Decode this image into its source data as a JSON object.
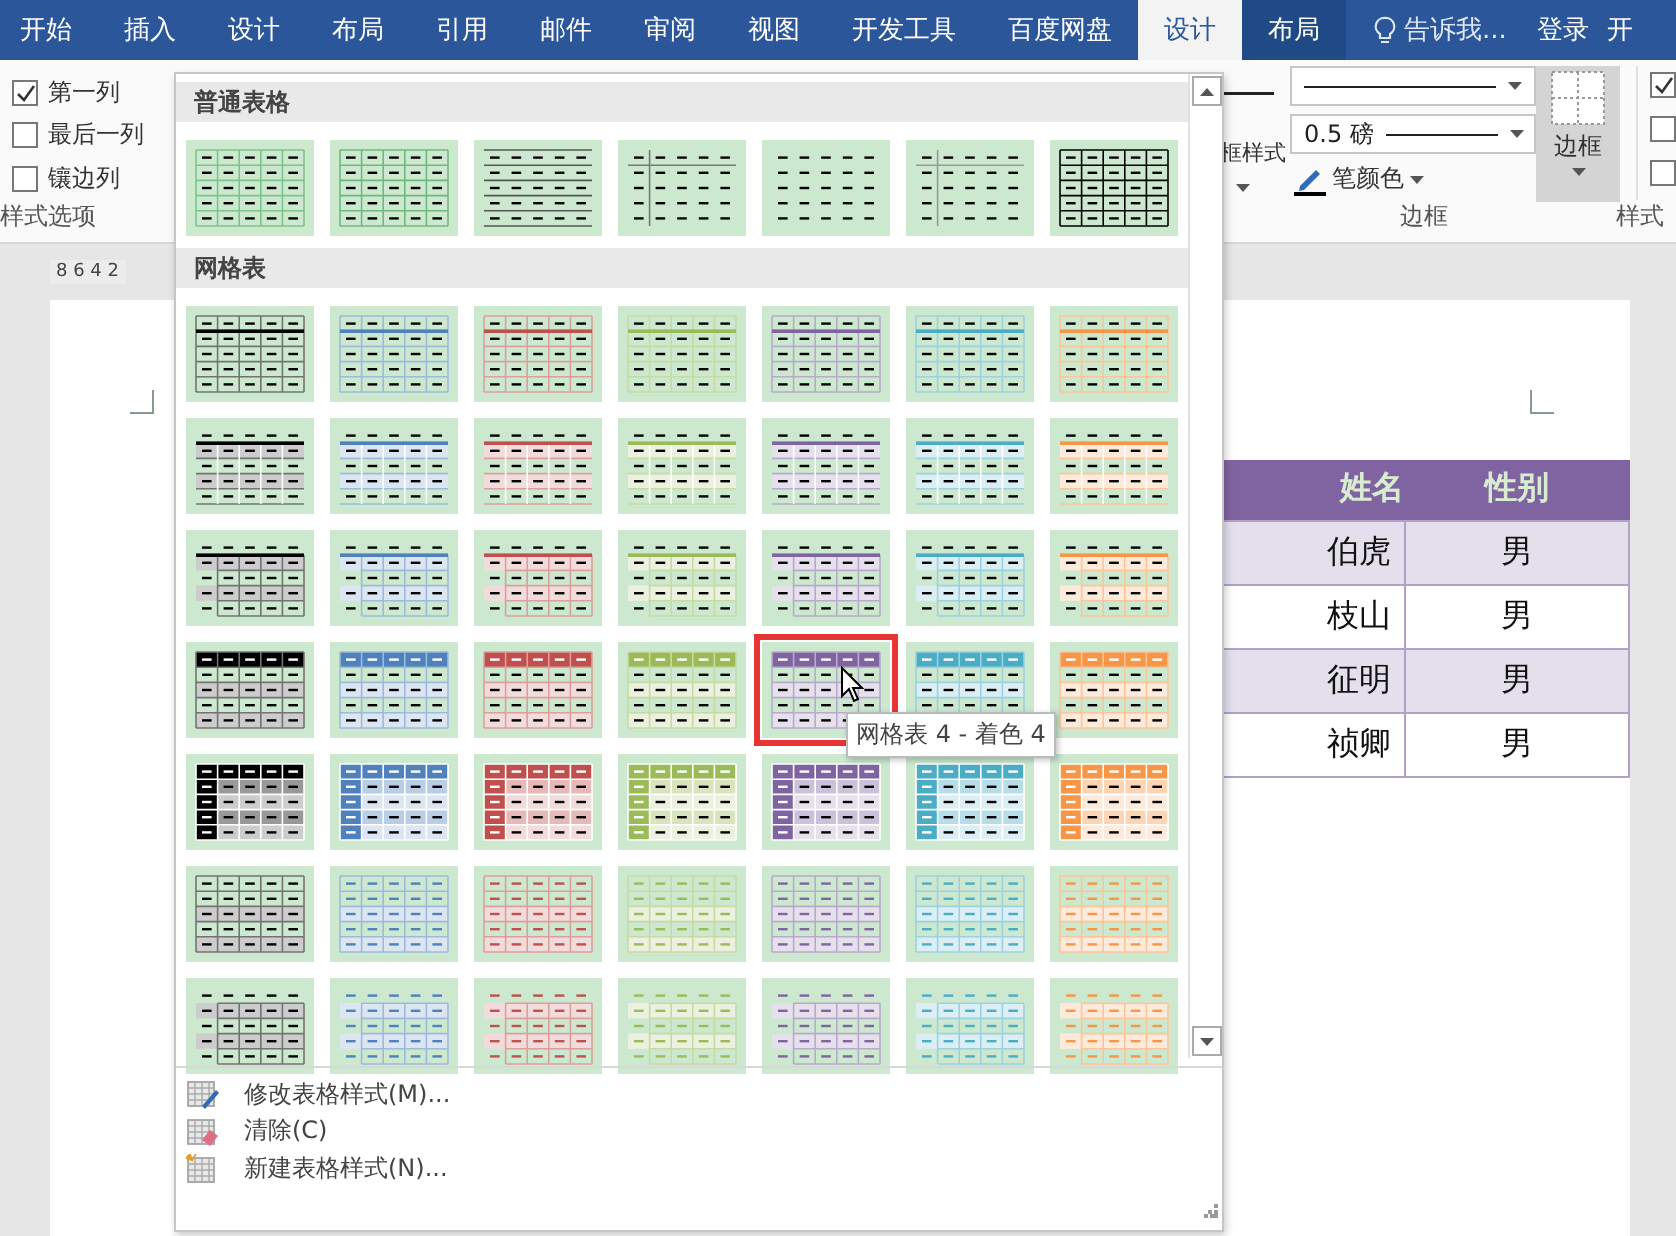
{
  "tabs": [
    {
      "label": "开始",
      "selected": false,
      "kind": "main"
    },
    {
      "label": "插入",
      "selected": false,
      "kind": "main"
    },
    {
      "label": "设计",
      "selected": false,
      "kind": "main"
    },
    {
      "label": "布局",
      "selected": false,
      "kind": "main"
    },
    {
      "label": "引用",
      "selected": false,
      "kind": "main"
    },
    {
      "label": "邮件",
      "selected": false,
      "kind": "main"
    },
    {
      "label": "审阅",
      "selected": false,
      "kind": "main"
    },
    {
      "label": "视图",
      "selected": false,
      "kind": "main"
    },
    {
      "label": "开发工具",
      "selected": false,
      "kind": "main"
    },
    {
      "label": "百度网盘",
      "selected": false,
      "kind": "main"
    },
    {
      "label": "设计",
      "selected": true,
      "kind": "context"
    },
    {
      "label": "布局",
      "selected": false,
      "kind": "context"
    }
  ],
  "tell_me": "告诉我...",
  "sign_in": "登录",
  "cut_tab": "开",
  "style_options": {
    "items": [
      {
        "label": "第一列",
        "checked": true
      },
      {
        "label": "最后一列",
        "checked": false
      },
      {
        "label": "镶边列",
        "checked": false
      }
    ],
    "group_label": "样式选项"
  },
  "borders": {
    "border_styles_label": "框样式",
    "pen_weight": "0.5 磅",
    "pen_color_label": "笔颜色",
    "borders_button": "边框",
    "group_label": "边框"
  },
  "right_options": {
    "items": [
      {
        "checked": true
      },
      {
        "checked": false
      },
      {
        "checked": false
      }
    ],
    "group_label": "样式"
  },
  "ruler": "8 6 4 2",
  "document_table": {
    "columns": [
      "姓名",
      "性别"
    ],
    "rows": [
      [
        "伯虎",
        "男"
      ],
      [
        "枝山",
        "男"
      ],
      [
        "征明",
        "男"
      ],
      [
        "祯卿",
        "男"
      ]
    ]
  },
  "gallery": {
    "sections": [
      {
        "title": "普通表格",
        "items": [
          {
            "kind": "plain-grid-light",
            "selected": false
          },
          {
            "kind": "plain-grid",
            "selected": false
          },
          {
            "kind": "plain-rules",
            "selected": false
          },
          {
            "kind": "plain-corner",
            "selected": false
          },
          {
            "kind": "plain-none",
            "selected": false
          },
          {
            "kind": "plain-corner-light",
            "selected": false
          },
          {
            "kind": "plain-grid-dark",
            "selected": false
          }
        ]
      },
      {
        "title": "网格表",
        "items": [
          {
            "kind": "grid1",
            "color": "#000000",
            "selected": false
          },
          {
            "kind": "grid1",
            "color": "#4f81bd",
            "selected": false
          },
          {
            "kind": "grid1",
            "color": "#c0504d",
            "selected": false
          },
          {
            "kind": "grid1",
            "color": "#9bbb59",
            "selected": false
          },
          {
            "kind": "grid1",
            "color": "#8064a2",
            "selected": false
          },
          {
            "kind": "grid1",
            "color": "#4bacc6",
            "selected": false
          },
          {
            "kind": "grid1",
            "color": "#f79646",
            "selected": false
          },
          {
            "kind": "grid2",
            "color": "#000000",
            "selected": false
          },
          {
            "kind": "grid2",
            "color": "#4f81bd",
            "selected": false
          },
          {
            "kind": "grid2",
            "color": "#c0504d",
            "selected": false
          },
          {
            "kind": "grid2",
            "color": "#9bbb59",
            "selected": false
          },
          {
            "kind": "grid2",
            "color": "#8064a2",
            "selected": false
          },
          {
            "kind": "grid2",
            "color": "#4bacc6",
            "selected": false
          },
          {
            "kind": "grid2",
            "color": "#f79646",
            "selected": false
          },
          {
            "kind": "grid3",
            "color": "#000000",
            "selected": false
          },
          {
            "kind": "grid3",
            "color": "#4f81bd",
            "selected": false
          },
          {
            "kind": "grid3",
            "color": "#c0504d",
            "selected": false
          },
          {
            "kind": "grid3",
            "color": "#9bbb59",
            "selected": false
          },
          {
            "kind": "grid3",
            "color": "#8064a2",
            "selected": false
          },
          {
            "kind": "grid3",
            "color": "#4bacc6",
            "selected": false
          },
          {
            "kind": "grid3",
            "color": "#f79646",
            "selected": false
          },
          {
            "kind": "grid4",
            "color": "#000000",
            "selected": false
          },
          {
            "kind": "grid4",
            "color": "#4f81bd",
            "selected": false
          },
          {
            "kind": "grid4",
            "color": "#c0504d",
            "selected": false
          },
          {
            "kind": "grid4",
            "color": "#9bbb59",
            "selected": false
          },
          {
            "kind": "grid4",
            "color": "#8064a2",
            "selected": true
          },
          {
            "kind": "grid4",
            "color": "#4bacc6",
            "selected": false
          },
          {
            "kind": "grid4",
            "color": "#f79646",
            "selected": false
          },
          {
            "kind": "grid5",
            "color": "#000000",
            "selected": false
          },
          {
            "kind": "grid5",
            "color": "#4f81bd",
            "selected": false
          },
          {
            "kind": "grid5",
            "color": "#c0504d",
            "selected": false
          },
          {
            "kind": "grid5",
            "color": "#9bbb59",
            "selected": false
          },
          {
            "kind": "grid5",
            "color": "#8064a2",
            "selected": false
          },
          {
            "kind": "grid5",
            "color": "#4bacc6",
            "selected": false
          },
          {
            "kind": "grid5",
            "color": "#f79646",
            "selected": false
          },
          {
            "kind": "grid6",
            "color": "#000000",
            "selected": false
          },
          {
            "kind": "grid6",
            "color": "#4f81bd",
            "selected": false
          },
          {
            "kind": "grid6",
            "color": "#c0504d",
            "selected": false
          },
          {
            "kind": "grid6",
            "color": "#9bbb59",
            "selected": false
          },
          {
            "kind": "grid6",
            "color": "#8064a2",
            "selected": false
          },
          {
            "kind": "grid6",
            "color": "#4bacc6",
            "selected": false
          },
          {
            "kind": "grid6",
            "color": "#f79646",
            "selected": false
          },
          {
            "kind": "grid7",
            "color": "#000000",
            "selected": false
          },
          {
            "kind": "grid7",
            "color": "#4f81bd",
            "selected": false
          },
          {
            "kind": "grid7",
            "color": "#c0504d",
            "selected": false
          },
          {
            "kind": "grid7",
            "color": "#9bbb59",
            "selected": false
          },
          {
            "kind": "grid7",
            "color": "#8064a2",
            "selected": false
          },
          {
            "kind": "grid7",
            "color": "#4bacc6",
            "selected": false
          },
          {
            "kind": "grid7",
            "color": "#f79646",
            "selected": false
          }
        ]
      }
    ],
    "tooltip": "网格表 4 - 着色 4",
    "menu": [
      {
        "label": "修改表格样式(M)...",
        "kind": "modify"
      },
      {
        "label": "清除(C)",
        "kind": "clear"
      },
      {
        "label": "新建表格样式(N)...",
        "kind": "new"
      }
    ]
  }
}
